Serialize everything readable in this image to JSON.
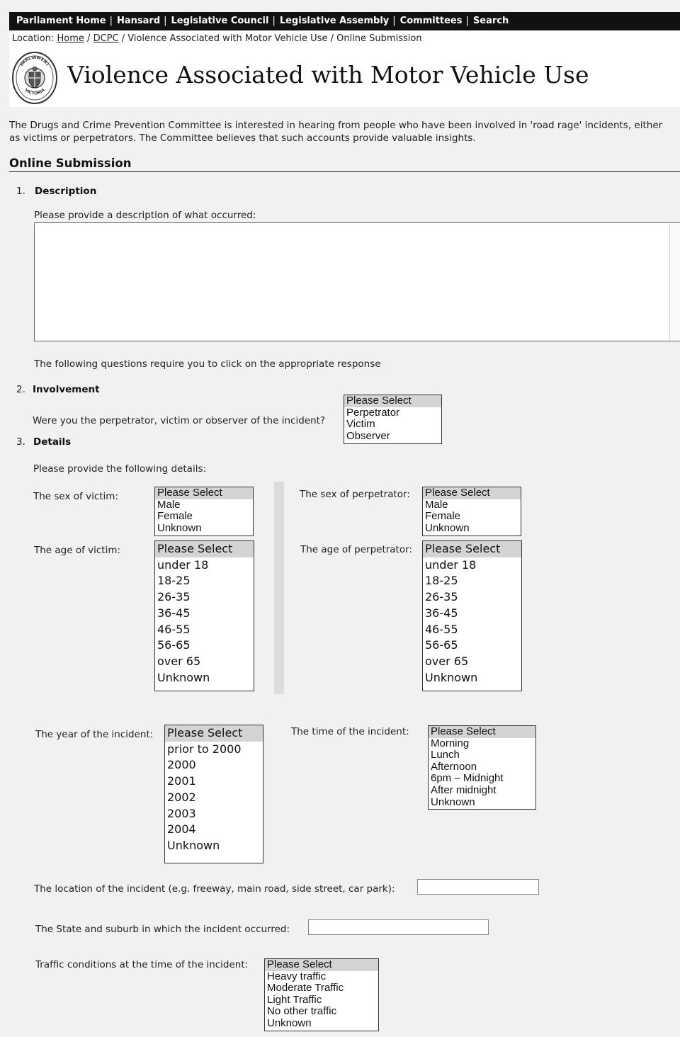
{
  "nav": {
    "items": [
      "Parliament Home",
      "Hansard",
      "Legislative Council",
      "Legislative Assembly",
      "Committees",
      "Search"
    ],
    "separator": "|"
  },
  "breadcrumb": {
    "prefix": "Location:",
    "home": "Home",
    "dcpc": "DCPC",
    "rest": "/ Violence Associated with Motor Vehicle Use / Online Submission",
    "slash": "/"
  },
  "seal": {
    "top_text": "PARLIAMENT",
    "bottom_text": "VICTORIA"
  },
  "page_title": "Violence Associated with Motor Vehicle Use",
  "intro": "The Drugs and Crime Prevention Committee is interested in hearing from people who have been involved in 'road rage' incidents, either as victims or perpetrators. The Committee believes that such accounts provide valuable insights.",
  "section_title": "Online Submission",
  "q1": {
    "num": "1.",
    "title": "Description",
    "prompt": "Please provide a description of what occurred:",
    "description_value": ""
  },
  "instruction": "The following questions require you to click on the appropriate response",
  "q2": {
    "num": "2.",
    "title": "Involvement",
    "prompt": "Were you the perpetrator, victim or observer of the incident?",
    "options": [
      "Please Select",
      "Perpetrator",
      "Victim",
      "Observer"
    ]
  },
  "q3": {
    "num": "3.",
    "title": "Details",
    "prompt": "Please provide the following details:",
    "sex_victim_label": "The sex of victim:",
    "sex_perp_label": "The sex of perpetrator:",
    "sex_options": [
      "Please Select",
      "Male",
      "Female",
      "Unknown"
    ],
    "age_victim_label": "The age of victim:",
    "age_perp_label": "The age of perpetrator:",
    "age_options": [
      "Please Select",
      "under 18",
      "18-25",
      "26-35",
      "36-45",
      "46-55",
      "56-65",
      "over 65",
      "Unknown"
    ],
    "year_label": "The year of the incident:",
    "year_options": [
      "Please Select",
      "prior to 2000",
      "2000",
      "2001",
      "2002",
      "2003",
      "2004",
      "Unknown"
    ],
    "time_label": "The time of the incident:",
    "time_options": [
      "Please Select",
      "Morning",
      "Lunch",
      "Afternoon",
      "6pm – Midnight",
      "After midnight",
      "Unknown"
    ],
    "location_label": "The location of the incident (e.g. freeway, main road, side street, car park):",
    "location_value": "",
    "state_label": "The State and suburb in which the incident occurred:",
    "state_value": "",
    "traffic_label": "Traffic conditions at the time of the incident:",
    "traffic_options": [
      "Please Select",
      "Heavy traffic",
      "Moderate Traffic",
      "Light Traffic",
      "No other traffic",
      "Unknown"
    ]
  },
  "selected_option": "Please Select"
}
